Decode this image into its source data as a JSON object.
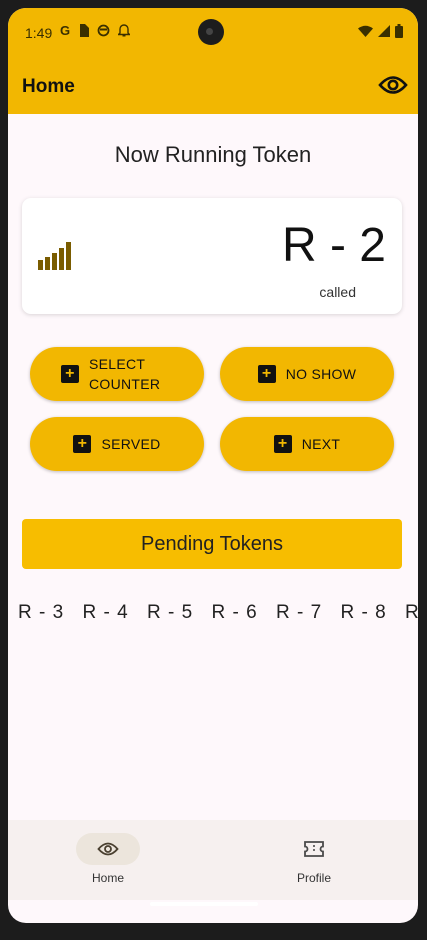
{
  "status_bar": {
    "time": "1:49",
    "left_icons": [
      "google-icon",
      "sim-icon",
      "face-icon",
      "bell-icon"
    ],
    "right_icons": [
      "wifi-icon",
      "signal-icon",
      "battery-icon"
    ]
  },
  "app_bar": {
    "title": "Home",
    "action_icon": "eye-icon"
  },
  "now_running": {
    "title": "Now Running Token",
    "token": "R - 2",
    "status": "called",
    "icon": "signal-bars-icon"
  },
  "actions": [
    {
      "label": "SELECT COUNTER"
    },
    {
      "label": "NO SHOW"
    },
    {
      "label": "SERVED"
    },
    {
      "label": "NEXT"
    }
  ],
  "pending": {
    "button_label": "Pending Tokens",
    "tokens": [
      "R - 3",
      "R - 4",
      "R - 5",
      "R - 6",
      "R - 7",
      "R - 8",
      "R"
    ]
  },
  "bottom_nav": [
    {
      "label": "Home",
      "icon": "eye-icon",
      "active": true
    },
    {
      "label": "Profile",
      "icon": "ticket-icon",
      "active": false
    }
  ],
  "colors": {
    "primary": "#f2b701",
    "background": "#fef8fb",
    "nav_background": "#f6f0ef"
  }
}
